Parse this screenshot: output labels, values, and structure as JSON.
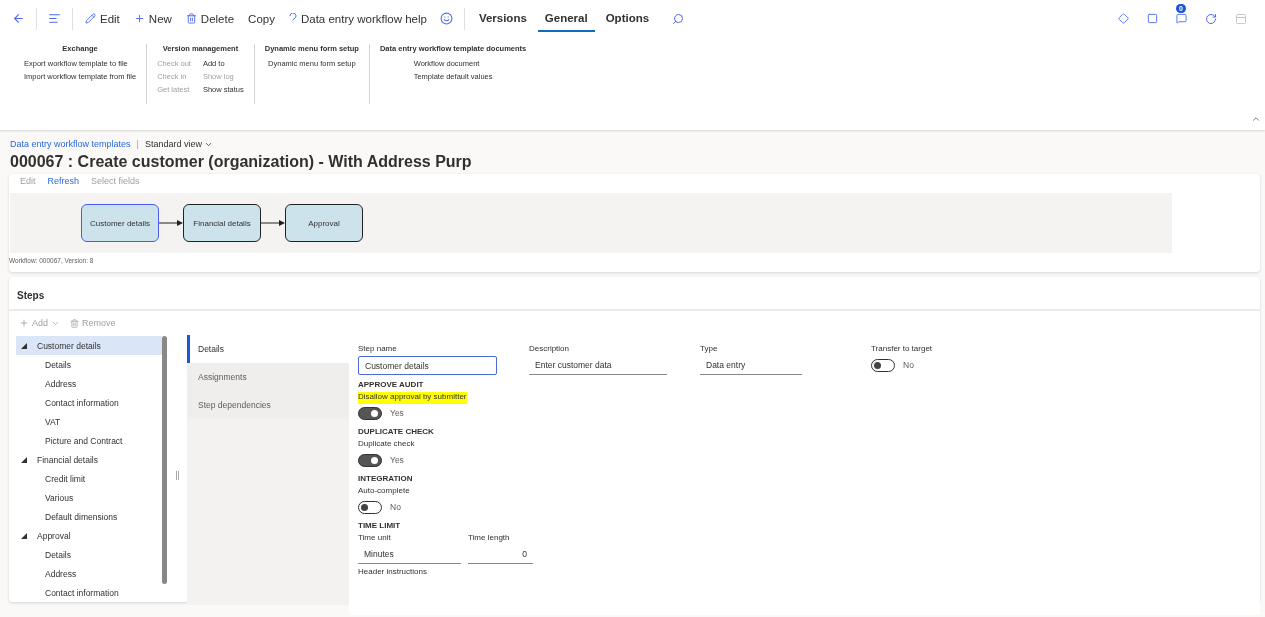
{
  "actions": [
    {
      "label": "Edit"
    },
    {
      "label": "New"
    },
    {
      "label": "Delete"
    },
    {
      "label": "Copy"
    },
    {
      "label": "Data entry workflow help"
    }
  ],
  "tabs": [
    {
      "label": "Versions",
      "selected": false
    },
    {
      "label": "General",
      "selected": true
    },
    {
      "label": "Options",
      "selected": false
    }
  ],
  "notifications": {
    "count": "0"
  },
  "ribbon": [
    {
      "title": "Exchange",
      "columns": [
        [
          {
            "label": "Export workflow template to file",
            "disabled": false
          },
          {
            "label": "Import workflow template from file",
            "disabled": false
          }
        ]
      ]
    },
    {
      "title": "Version management",
      "columns": [
        [
          {
            "label": "Check out",
            "disabled": true
          },
          {
            "label": "Check in",
            "disabled": true
          },
          {
            "label": "Get latest",
            "disabled": true
          }
        ],
        [
          {
            "label": "Add to",
            "disabled": false
          },
          {
            "label": "Show log",
            "disabled": true
          },
          {
            "label": "Show status",
            "disabled": false
          }
        ]
      ]
    },
    {
      "title": "Dynamic menu form setup",
      "columns": [
        [
          {
            "label": "Dynamic menu form setup",
            "disabled": false
          }
        ]
      ]
    },
    {
      "title": "Data entry workflow template documents",
      "columns": [
        [
          {
            "label": "Workflow document",
            "disabled": false
          },
          {
            "label": "Template default values",
            "disabled": false
          }
        ]
      ]
    }
  ],
  "breadcrumb": {
    "link": "Data entry workflow templates",
    "separator": "|",
    "view": "Standard view"
  },
  "title": "000067 : Create customer (organization) - With Address Purp",
  "diagram": {
    "toolbar": [
      {
        "label": "Edit",
        "disabled": true
      },
      {
        "label": "Refresh",
        "disabled": false
      },
      {
        "label": "Select fields",
        "disabled": true
      }
    ],
    "nodes": [
      {
        "label": "Customer details",
        "selected": true
      },
      {
        "label": "Financial details",
        "selected": false
      },
      {
        "label": "Approval",
        "selected": false
      }
    ],
    "caption": "Workflow: 000067, Version: 8"
  },
  "steps": {
    "title": "Steps",
    "toolbar": [
      {
        "label": "Add",
        "disabled": true
      },
      {
        "label": "Remove",
        "disabled": true
      }
    ],
    "tree": [
      {
        "label": "Customer details",
        "expanded": true,
        "selected": true,
        "children": [
          {
            "label": "Details",
            "selected": false
          },
          {
            "label": "Address",
            "selected": false
          },
          {
            "label": "Contact information",
            "selected": false
          },
          {
            "label": "VAT",
            "selected": false
          },
          {
            "label": "Picture and Contract",
            "selected": false
          }
        ]
      },
      {
        "label": "Financial details",
        "expanded": true,
        "selected": false,
        "children": [
          {
            "label": "Credit limit",
            "selected": false
          },
          {
            "label": "Various",
            "selected": false
          },
          {
            "label": "Default dimensions",
            "selected": false
          }
        ]
      },
      {
        "label": "Approval",
        "expanded": true,
        "selected": false,
        "children": [
          {
            "label": "Details",
            "selected": false
          },
          {
            "label": "Address",
            "selected": false
          },
          {
            "label": "Contact information",
            "selected": false
          }
        ]
      }
    ],
    "tabs": [
      {
        "label": "Details",
        "selected": true
      },
      {
        "label": "Assignments",
        "selected": false
      },
      {
        "label": "Step dependencies",
        "selected": false
      }
    ],
    "fields": [
      {
        "label": "Step name",
        "value": "Customer details",
        "focused": true
      },
      {
        "label": "Description",
        "value": "Enter customer data",
        "focused": false
      },
      {
        "label": "Type",
        "value": "Data entry",
        "focused": false
      }
    ],
    "transfer": {
      "label": "Transfer to target",
      "on": false,
      "text": "No"
    },
    "sections": [
      {
        "heading": "APPROVE AUDIT",
        "items": [
          {
            "kind": "toggle",
            "label": "Disallow approval by submitter",
            "highlighted": true,
            "on": true,
            "text": "Yes"
          }
        ]
      },
      {
        "heading": "DUPLICATE CHECK",
        "items": [
          {
            "kind": "toggle",
            "label": "Duplicate check",
            "highlighted": false,
            "on": true,
            "text": "Yes"
          }
        ]
      },
      {
        "heading": "INTEGRATION",
        "items": [
          {
            "kind": "toggle",
            "label": "Auto-complete",
            "highlighted": false,
            "on": false,
            "text": "No"
          }
        ]
      },
      {
        "heading": "TIME LIMIT",
        "items": [
          {
            "kind": "fields",
            "fields": [
              {
                "label": "Time unit",
                "value": "Minutes",
                "kind": "text"
              },
              {
                "label": "Time length",
                "value": "0",
                "kind": "number"
              }
            ]
          }
        ]
      }
    ],
    "footer_label": "Header instructions"
  }
}
